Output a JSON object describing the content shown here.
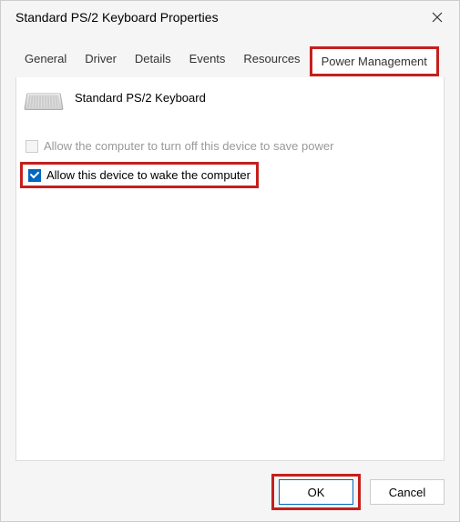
{
  "titlebar": {
    "title": "Standard PS/2 Keyboard Properties"
  },
  "tabs": {
    "items": [
      {
        "label": "General"
      },
      {
        "label": "Driver"
      },
      {
        "label": "Details"
      },
      {
        "label": "Events"
      },
      {
        "label": "Resources"
      },
      {
        "label": "Power Management"
      }
    ]
  },
  "device": {
    "name": "Standard PS/2 Keyboard"
  },
  "options": {
    "turn_off_label": "Allow the computer to turn off this device to save power",
    "wake_label": "Allow this device to wake the computer"
  },
  "buttons": {
    "ok": "OK",
    "cancel": "Cancel"
  }
}
